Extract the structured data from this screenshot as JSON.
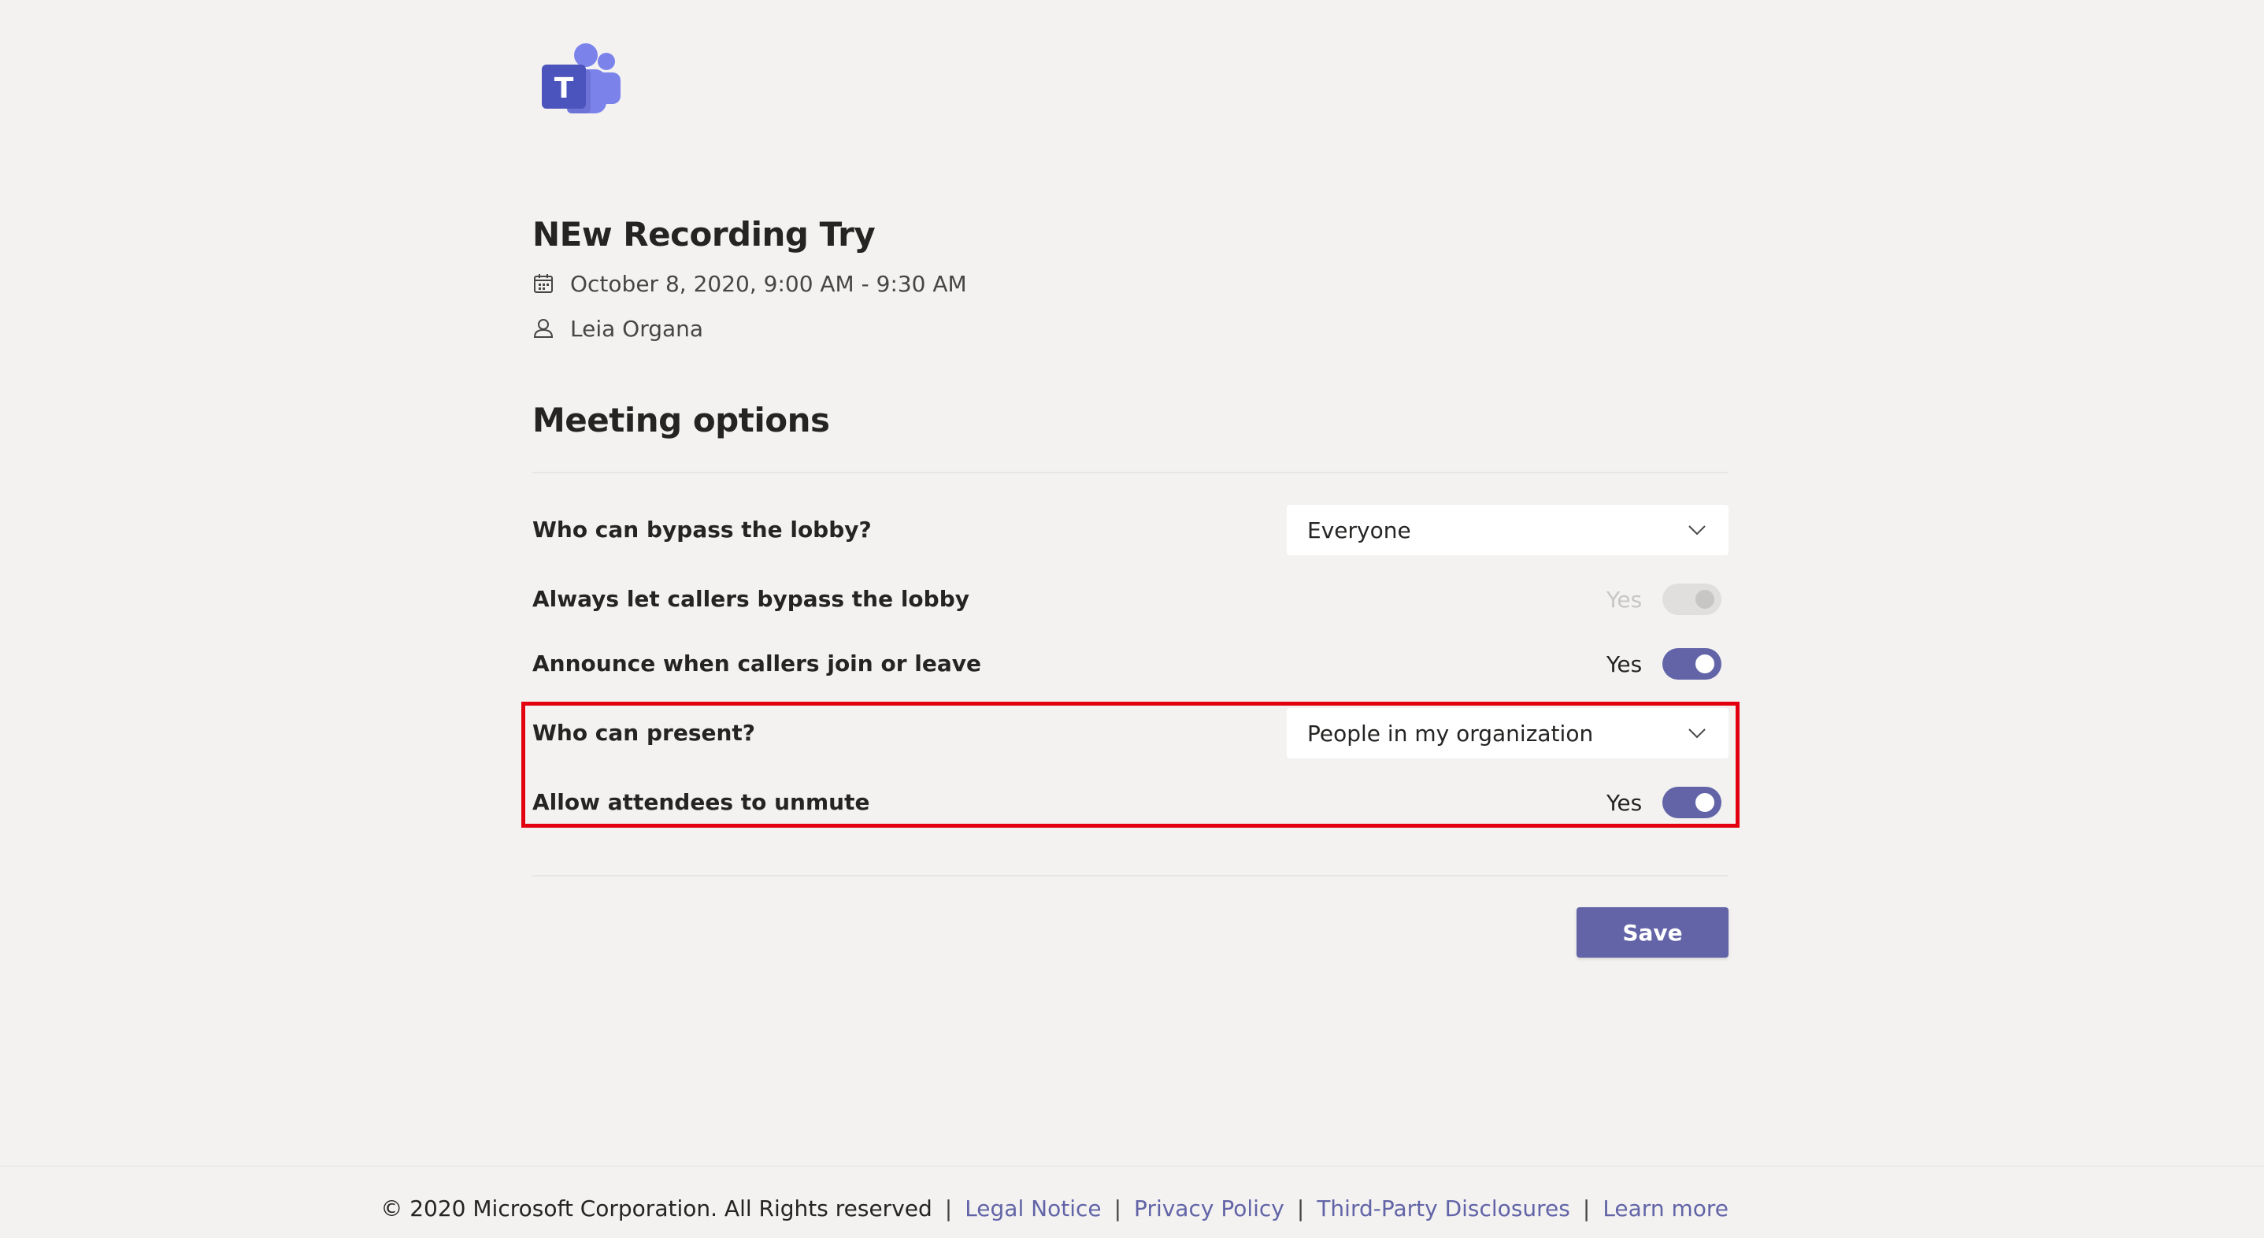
{
  "brand": {
    "logo_icon": "teams-logo-icon",
    "logo_letter": "T",
    "accent_color": "#6264a7"
  },
  "meeting": {
    "title": "NEw Recording Try",
    "date_icon": "calendar-icon",
    "datetime": "October 8, 2020, 9:00 AM - 9:30 AM",
    "organizer_icon": "person-icon",
    "organizer": "Leia Organa"
  },
  "options": {
    "section_title": "Meeting options",
    "bypass_lobby": {
      "label": "Who can bypass the lobby?",
      "selected": "Everyone"
    },
    "callers_bypass": {
      "label": "Always let callers bypass the lobby",
      "state_text": "Yes",
      "enabled": false
    },
    "announce_callers": {
      "label": "Announce when callers join or leave",
      "state_text": "Yes",
      "on": true
    },
    "who_can_present": {
      "label": "Who can present?",
      "selected": "People in my organization"
    },
    "attendees_unmute": {
      "label": "Allow attendees to unmute",
      "state_text": "Yes",
      "on": true
    },
    "highlight_color": "#e3000f"
  },
  "actions": {
    "save_label": "Save"
  },
  "footer": {
    "copyright": "© 2020 Microsoft Corporation. All Rights reserved",
    "separator": "|",
    "links": {
      "legal": "Legal Notice",
      "privacy": "Privacy Policy",
      "third_party": "Third-Party Disclosures",
      "learn_more": "Learn more"
    },
    "link_color": "#6264a7"
  }
}
